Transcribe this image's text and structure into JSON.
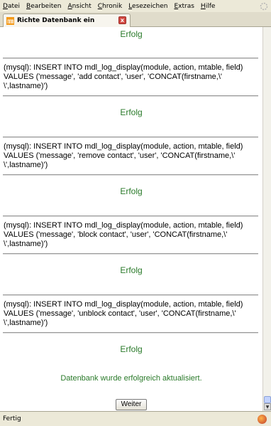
{
  "menu": [
    {
      "pre": "",
      "u": "D",
      "post": "atei"
    },
    {
      "pre": "",
      "u": "B",
      "post": "earbeiten"
    },
    {
      "pre": "",
      "u": "A",
      "post": "nsicht"
    },
    {
      "pre": "",
      "u": "C",
      "post": "hronik"
    },
    {
      "pre": "",
      "u": "L",
      "post": "esezeichen"
    },
    {
      "pre": "",
      "u": "E",
      "post": "xtras"
    },
    {
      "pre": "",
      "u": "H",
      "post": "ilfe"
    }
  ],
  "tab": {
    "title": "Richte Datenbank ein",
    "close": "x"
  },
  "page": {
    "success_label": "Erfolg",
    "queries": [
      "(mysql): INSERT INTO mdl_log_display(module, action, mtable, field) VALUES ('message', 'add contact', 'user', 'CONCAT(firstname,\\' \\',lastname)')",
      "(mysql): INSERT INTO mdl_log_display(module, action, mtable, field) VALUES ('message', 'remove contact', 'user', 'CONCAT(firstname,\\' \\',lastname)')",
      "(mysql): INSERT INTO mdl_log_display(module, action, mtable, field) VALUES ('message', 'block contact', 'user', 'CONCAT(firstname,\\' \\',lastname)')",
      "(mysql): INSERT INTO mdl_log_display(module, action, mtable, field) VALUES ('message', 'unblock contact', 'user', 'CONCAT(firstname,\\' \\',lastname)')"
    ],
    "final_message": "Datenbank wurde erfolgreich aktualisiert.",
    "continue_button": "Weiter"
  },
  "status": {
    "text": "Fertig"
  },
  "colors": {
    "success": "#2a7a2a"
  }
}
